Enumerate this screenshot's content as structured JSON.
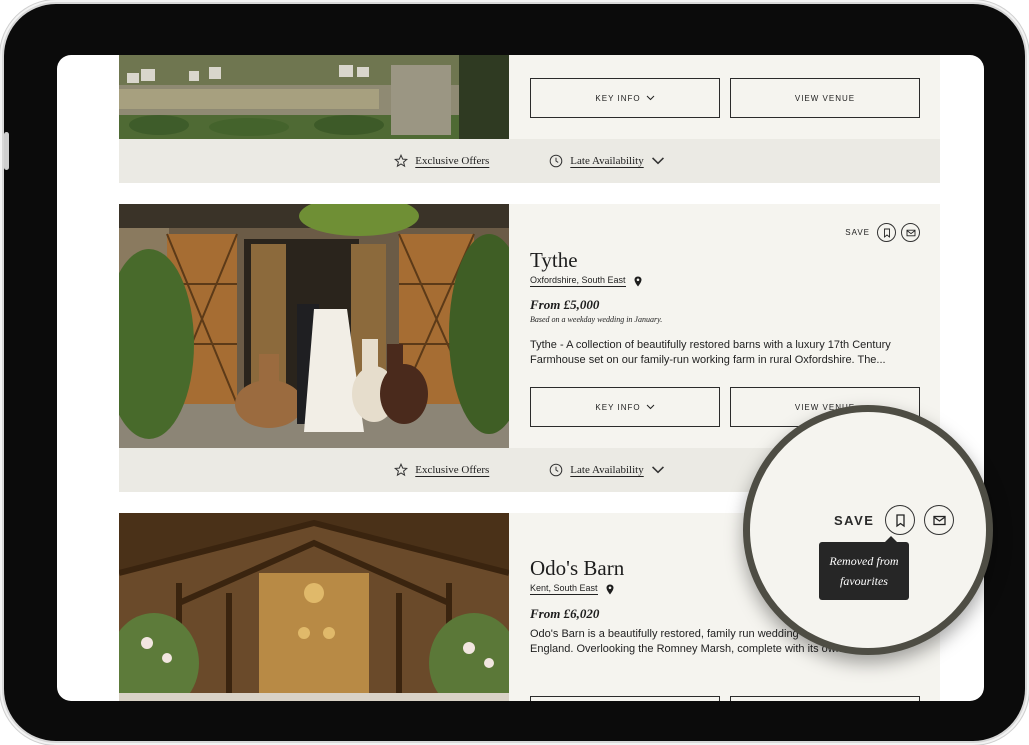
{
  "listings": [
    {
      "buttons": {
        "key_info": "KEY INFO",
        "view_venue": "VIEW VENUE"
      },
      "offers": {
        "exclusive": "Exclusive Offers",
        "late": "Late Availability"
      }
    },
    {
      "save_label": "SAVE",
      "name": "Tythe",
      "location": "Oxfordshire, South East",
      "price": "From £5,000",
      "price_note": "Based on a weekday wedding in January.",
      "description": "Tythe - A collection of beautifully restored barns with a luxury 17th Century Farmhouse set on our family-run working farm in rural Oxfordshire. The...",
      "buttons": {
        "key_info": "KEY INFO",
        "view_venue": "VIEW VENUE"
      },
      "offers": {
        "exclusive": "Exclusive Offers",
        "late": "Late Availability"
      }
    },
    {
      "name": "Odo's Barn",
      "location": "Kent, South East",
      "price": "From £6,020",
      "description": "Odo's Barn is a beautifully restored, family run wedding venue in the Garden of England. Overlooking the Romney Marsh, complete with its own..."
    }
  ],
  "magnifier": {
    "save_label": "SAVE",
    "tooltip_line1": "Removed from",
    "tooltip_line2": "favourites"
  },
  "icons": [
    "star-icon",
    "clock-icon",
    "chevron-down-icon",
    "bookmark-icon",
    "envelope-icon",
    "map-pin-icon"
  ],
  "colors": {
    "card_bg": "#f5f4ef",
    "offers_bar_bg": "#ebeae4",
    "frame": "#0b0b0b",
    "magnifier_ring": "#4e4d44",
    "tooltip_bg": "#262626"
  }
}
